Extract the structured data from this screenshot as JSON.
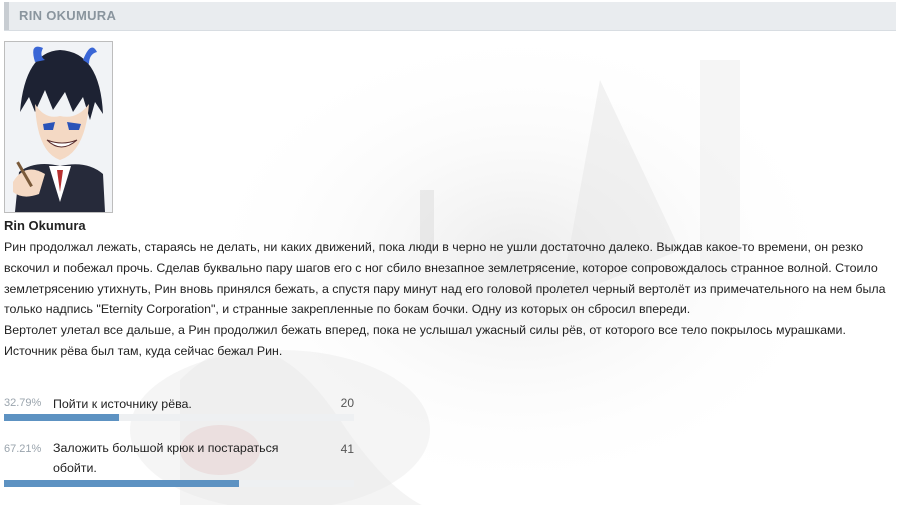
{
  "header": {
    "title": "RIN OKUMURA"
  },
  "post": {
    "character_name": "Rin Okumura",
    "paragraphs": [
      "Рин продолжал лежать, стараясь не делать, ни каких движений, пока люди в черно не ушли достаточно далеко. Выждав какое-то времени, он резко вскочил и побежал прочь. Сделав буквально пару шагов его с ног сбило внезапное землетрясение, которое сопровождалось странное волной. Стоило землетрясению утихнуть, Рин вновь принялся бежать, а спустя пару минут над его головой пролетел черный вертолёт из примечательного на нем была только надпись \"Eternity Corporation\", и странные закрепленные по бокам бочки. Одну из которых он сбросил впереди.",
      "Вертолет улетал все дальше, а Рин продолжил бежать вперед, пока не услышал ужасный силы рёв, от которого все тело покрылось мурашками. Источник рёва был там, куда сейчас бежал Рин."
    ]
  },
  "poll": {
    "options": [
      {
        "percent_label": "32.79%",
        "label": "Пойти к источнику рёва.",
        "votes": "20",
        "fraction": 0.3279
      },
      {
        "percent_label": "67.21%",
        "label": "Заложить большой крюк и постараться обойти.",
        "votes": "41",
        "fraction": 0.6721
      }
    ]
  },
  "colors": {
    "poll_fill": "#5d92c2",
    "title_bar": "#e9ecef",
    "title_text": "#8a959e"
  }
}
